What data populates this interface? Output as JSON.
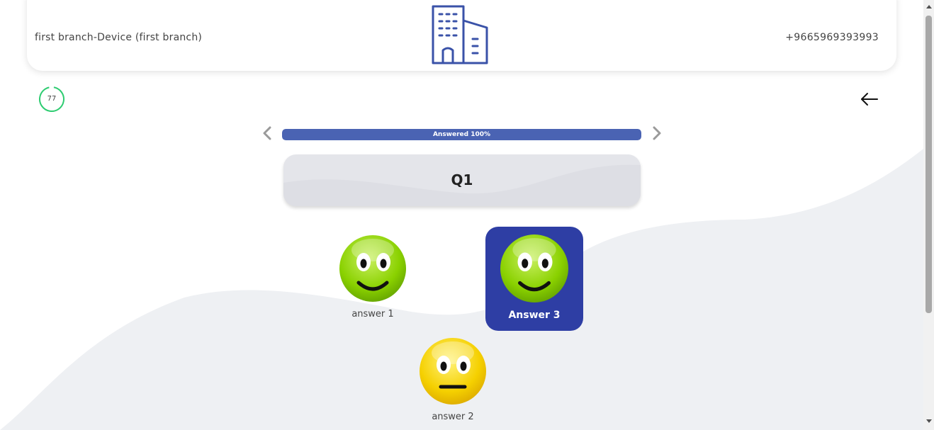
{
  "header": {
    "branch_device": "first branch-Device (first branch)",
    "phone": "+9665969393993",
    "logo_icon": "building-icon"
  },
  "timer": {
    "value": "77"
  },
  "nav": {
    "back_icon": "arrow-left-icon",
    "prev_icon": "chevron-left-icon",
    "next_icon": "chevron-right-icon"
  },
  "progress": {
    "label": "Answered 100%",
    "percent": 100,
    "color": "#4a63b3"
  },
  "question": {
    "title": "Q1"
  },
  "answers": [
    {
      "label": "answer 1",
      "icon": "happy-face-icon",
      "selected": false
    },
    {
      "label": "answer 2",
      "icon": "neutral-face-icon",
      "selected": false
    },
    {
      "label": "Answer 3",
      "icon": "happy-face-icon",
      "selected": true
    }
  ],
  "colors": {
    "accent": "#2e3ea4",
    "timer_ring": "#2ecc71",
    "wave": "#eef0f3"
  }
}
